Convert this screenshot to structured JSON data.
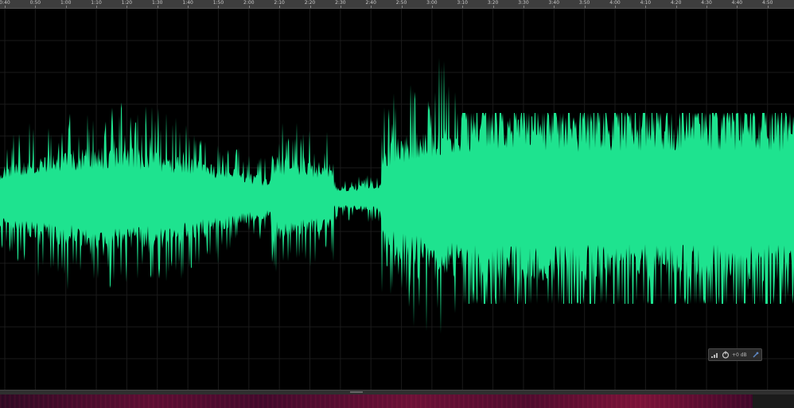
{
  "timeline": {
    "ticks": [
      "0:40",
      "0:50",
      "1:00",
      "1:10",
      "1:20",
      "1:30",
      "1:40",
      "1:50",
      "2:00",
      "2:10",
      "2:20",
      "2:30",
      "2:40",
      "2:50",
      "3:00",
      "3:10",
      "3:20",
      "3:30",
      "3:40",
      "3:50",
      "4:00",
      "4:10",
      "4:20",
      "4:30",
      "4:40",
      "4:50"
    ]
  },
  "waveform": {
    "color": "#1ee38f",
    "background": "#000000",
    "grid_color": "#1a1a1a"
  },
  "hud": {
    "gain": "+0 dB",
    "icons": [
      "meter-icon",
      "power-icon",
      "pin-icon"
    ]
  },
  "spectral": {
    "colors": [
      "#2a0a22",
      "#6a1236",
      "#7a1438"
    ]
  }
}
